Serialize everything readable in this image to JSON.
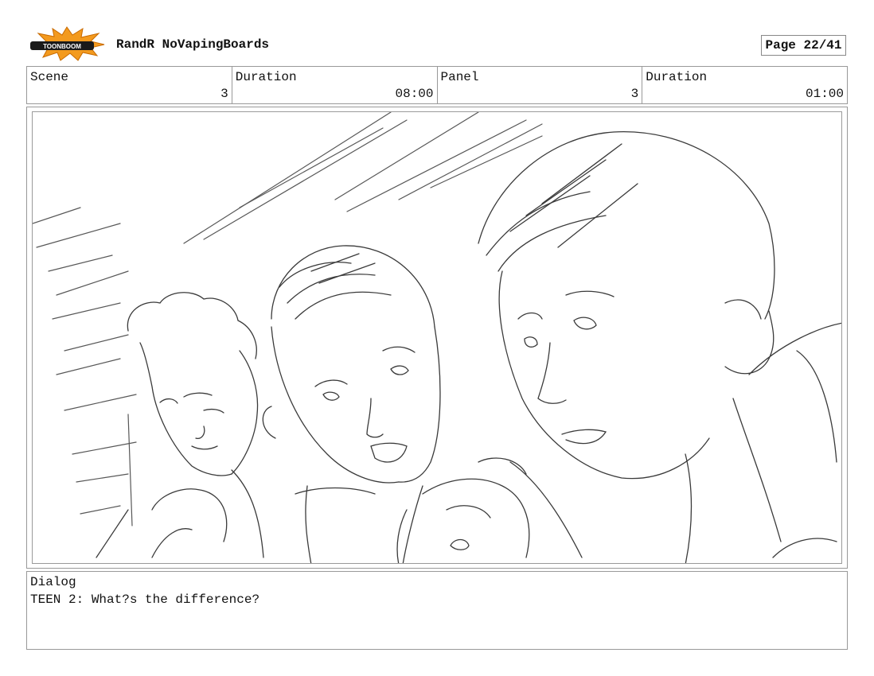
{
  "header": {
    "logo_text": "TOONBOOM",
    "project_title": "RandR NoVapingBoards",
    "page_label": "Page 22/41"
  },
  "info": {
    "scene_label": "Scene",
    "scene_value": "3",
    "scene_duration_label": "Duration",
    "scene_duration_value": "08:00",
    "panel_label": "Panel",
    "panel_value": "3",
    "panel_duration_label": "Duration",
    "panel_duration_value": "01:00"
  },
  "dialog": {
    "label": "Dialog",
    "text": "TEEN 2: What?s the difference?"
  },
  "colors": {
    "logo_burst": "#f39a1e",
    "logo_band": "#1a1a1a",
    "sketch_line": "#3a3a3a",
    "border": "#999999"
  }
}
